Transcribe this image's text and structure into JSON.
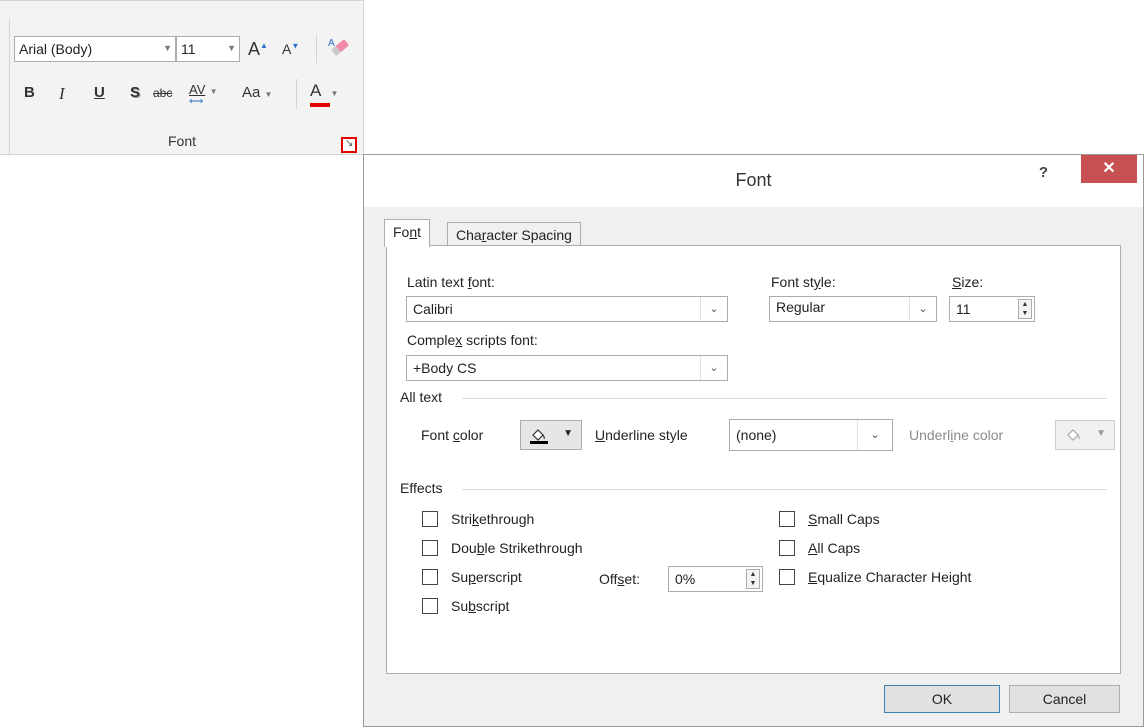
{
  "ribbon": {
    "font_name": "Arial (Body)",
    "font_size": "11",
    "group_label": "Font",
    "buttons": {
      "grow": "A",
      "shrink": "A",
      "bold": "B",
      "italic": "I",
      "underline": "U",
      "shadow": "S",
      "strike": "abc",
      "spacing": "AV",
      "case": "Aa",
      "color": "A"
    },
    "colors": {
      "font_color_bar": "#e00000",
      "launcher_highlight": "#e00000"
    }
  },
  "dialog": {
    "title": "Font",
    "help": "?",
    "close": "✕",
    "tabs": [
      {
        "pre": "Fo",
        "key": "n",
        "post": "t"
      },
      {
        "pre": "Cha",
        "key": "r",
        "post": "acter Spacing"
      }
    ],
    "latin_font": {
      "pre": "Latin text ",
      "key": "f",
      "post": "ont:",
      "value": "Calibri"
    },
    "font_style": {
      "pre": "Font st",
      "key": "y",
      "post": "le:",
      "value": "Regular"
    },
    "size": {
      "key": "S",
      "post": "ize:",
      "value": "11"
    },
    "complex_font": {
      "pre": "Comple",
      "key": "x",
      "post": " scripts font:",
      "value": "+Body CS"
    },
    "all_text": {
      "heading": "All text",
      "font_color": {
        "pre": "Font ",
        "key": "c",
        "post": "olor"
      },
      "underline_style": {
        "key": "U",
        "post": "nderline style",
        "value": "(none)"
      },
      "underline_color": {
        "pre": "Underl",
        "key": "i",
        "post": "ne color"
      }
    },
    "effects": {
      "heading": "Effects",
      "strikethrough": {
        "pre": "Stri",
        "key": "k",
        "post": "ethrough"
      },
      "double_strikethrough": {
        "pre": "Dou",
        "key": "b",
        "post": "le Strikethrough"
      },
      "superscript": {
        "pre": "Su",
        "key": "p",
        "post": "erscript"
      },
      "subscript": {
        "pre": "Su",
        "key": "b",
        "post": "script"
      },
      "offset": {
        "pre": "Off",
        "key": "s",
        "post": "et:",
        "value": "0%"
      },
      "small_caps": {
        "pre": "",
        "key": "S",
        "post": "mall Caps"
      },
      "all_caps": {
        "pre": "",
        "key": "A",
        "post": "ll Caps"
      },
      "equalize": {
        "pre": "",
        "key": "E",
        "post": "qualize Character Height"
      }
    },
    "ok": "OK",
    "cancel": "Cancel"
  }
}
